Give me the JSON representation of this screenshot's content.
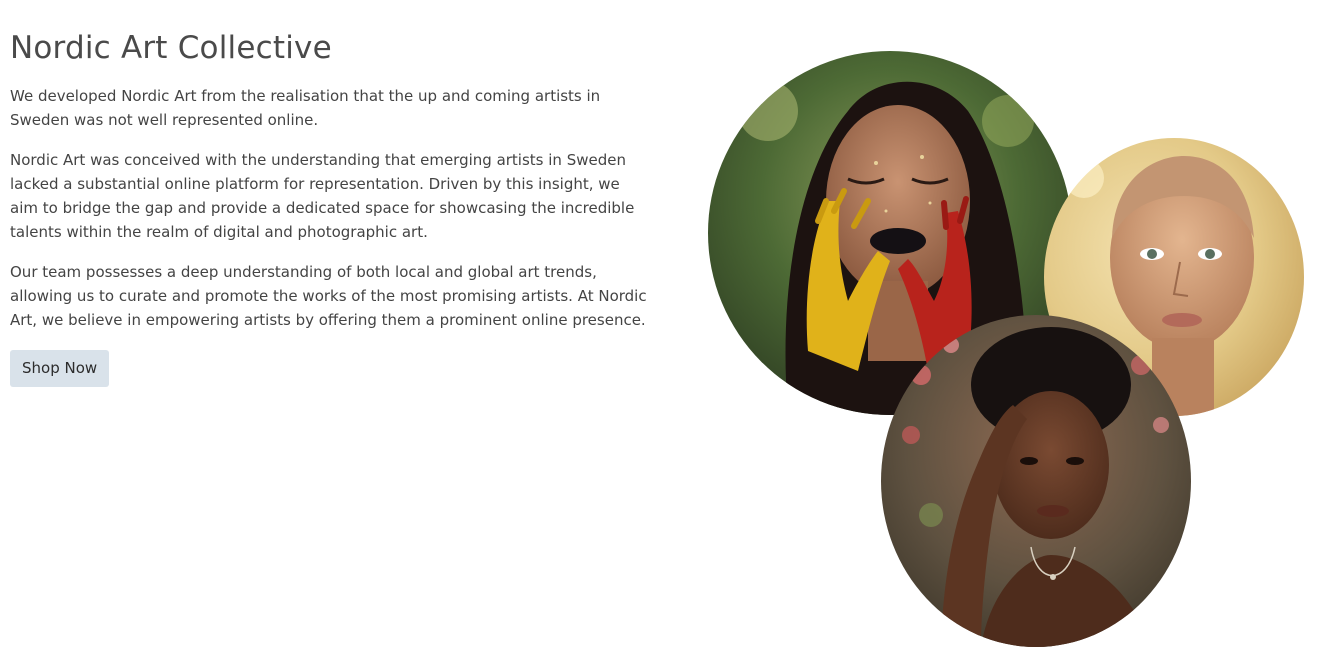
{
  "hero": {
    "title": "Nordic Art Collective",
    "paragraphs": [
      "We developed Nordic Art from the realisation that the up and coming artists in Sweden was not well represented online.",
      "Nordic Art was conceived with the understanding that emerging artists in Sweden lacked a substantial online platform for representation. Driven by this insight, we aim to bridge the gap and provide a dedicated space for showcasing the incredible talents within the realm of digital and photographic art.",
      "Our team possesses a deep understanding of both local and global art trends, allowing us to curate and promote the works of the most promising artists. At Nordic Art, we believe in empowering artists by offering them a prominent online presence."
    ],
    "cta_label": "Shop Now"
  },
  "colors": {
    "button_bg": "#d9e2ea",
    "text": "#444444"
  }
}
